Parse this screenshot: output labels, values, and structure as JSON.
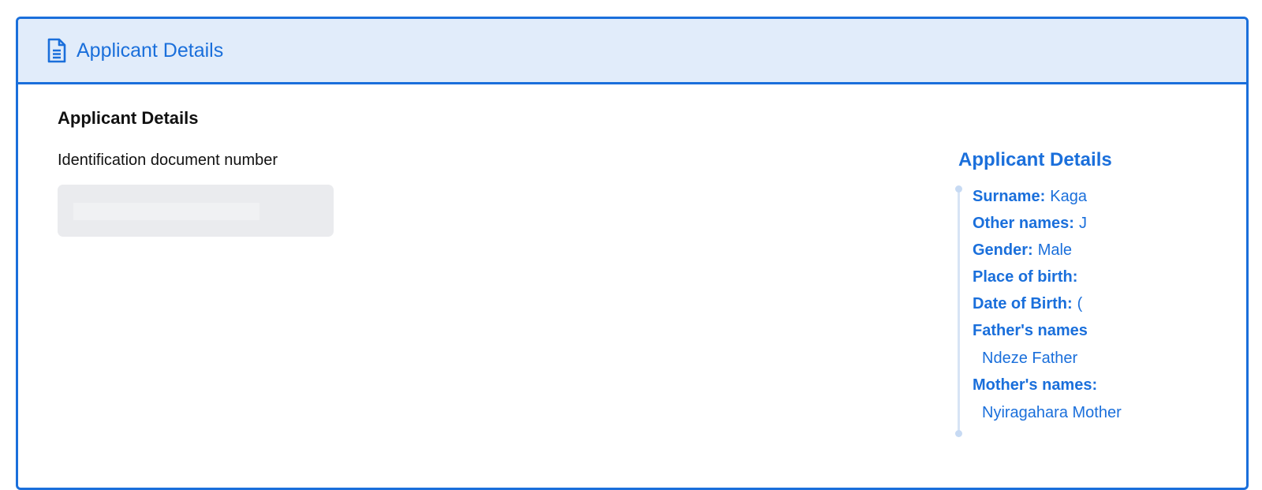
{
  "header": {
    "title": "Applicant Details",
    "icon": "document-icon"
  },
  "form": {
    "section_title": "Applicant Details",
    "id_label": "Identification document number",
    "id_value": ""
  },
  "aside": {
    "title": "Applicant Details",
    "rows": [
      {
        "key": "Surname:",
        "value": "Kaga"
      },
      {
        "key": "Other names:",
        "value": "J"
      },
      {
        "key": "Gender:",
        "value": "Male"
      },
      {
        "key": "Place of birth:",
        "value": ""
      },
      {
        "key": "Date of Birth:",
        "value": "("
      }
    ],
    "father_label": "Father's names",
    "father_value": "Ndeze Father",
    "mother_label": "Mother's names:",
    "mother_value": "Nyiragahara Mother"
  },
  "colors": {
    "accent": "#1a6fdb",
    "header_bg": "#e1ecfa",
    "input_bg": "#eaebee"
  }
}
